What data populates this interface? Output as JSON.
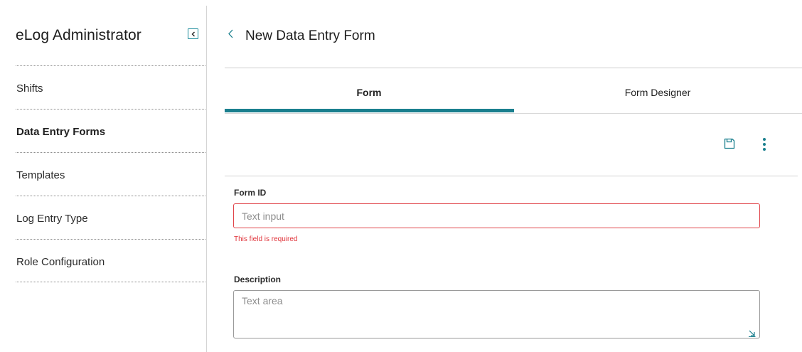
{
  "sidebar": {
    "title": "eLog Administrator",
    "collapse_icon": "chevron-left-icon",
    "items": [
      {
        "label": "Shifts",
        "active": false
      },
      {
        "label": "Data Entry Forms",
        "active": true
      },
      {
        "label": "Templates",
        "active": false
      },
      {
        "label": "Log Entry Type",
        "active": false
      },
      {
        "label": "Role Configuration",
        "active": false
      }
    ]
  },
  "header": {
    "back_icon": "chevron-left-icon",
    "title": "New Data Entry Form"
  },
  "tabs": [
    {
      "label": "Form",
      "active": true
    },
    {
      "label": "Form Designer",
      "active": false
    }
  ],
  "toolbar": {
    "save_icon": "save-icon",
    "more_icon": "more-vertical-icon"
  },
  "form": {
    "form_id": {
      "label": "Form ID",
      "value": "",
      "placeholder": "Text input",
      "error": "This field is required"
    },
    "description": {
      "label": "Description",
      "value": "",
      "placeholder": "Text area"
    }
  },
  "colors": {
    "accent": "#1a7f8e",
    "error": "#e0333a",
    "divider": "#d0d0d0"
  }
}
